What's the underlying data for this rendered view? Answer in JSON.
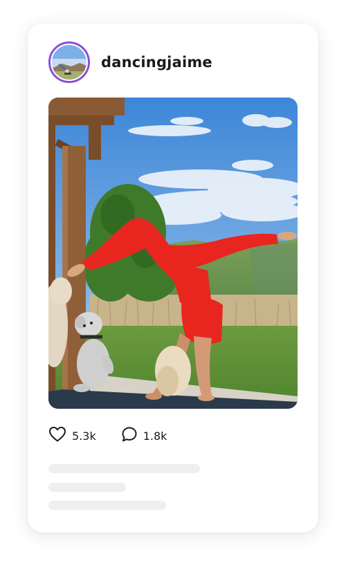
{
  "post": {
    "username": "dancingjaime",
    "likes": "5.3k",
    "comments": "1.8k"
  },
  "icons": {
    "like": "heart-outline-icon",
    "comment": "speech-bubble-icon"
  },
  "colors": {
    "avatar_ring": "#8a4fd6",
    "skeleton": "#efefef",
    "text": "#1a1a1a"
  }
}
